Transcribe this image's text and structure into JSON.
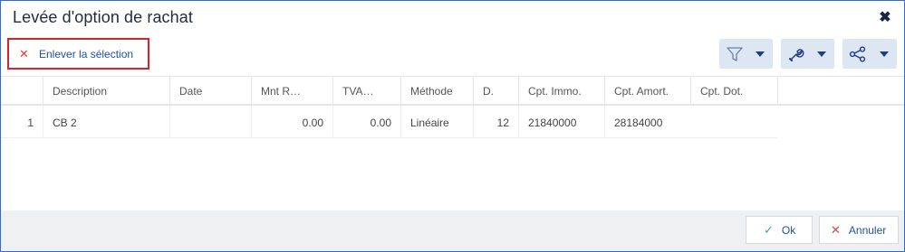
{
  "dialog": {
    "title": "Levée d'option de rachat",
    "close_icon": "close-icon"
  },
  "toolbar": {
    "clear_selection_label": "Enlever la sélection",
    "clear_icon": "x-icon",
    "filter_icon": "filter-icon",
    "tools_icon": "wrench-icon",
    "share_icon": "share-icon"
  },
  "grid": {
    "columns": [
      "",
      "Description",
      "Date",
      "Mnt R…",
      "TVA…",
      "Méthode",
      "D.",
      "Cpt. Immo.",
      "Cpt. Amort.",
      "Cpt. Dot."
    ],
    "rows": [
      {
        "num": "1",
        "description": "CB 2",
        "date": "",
        "mnt": "0.00",
        "tva": "0.00",
        "methode": "Linéaire",
        "d": "12",
        "cpt_immo": "21840000",
        "cpt_amort": "28184000",
        "cpt_dot": ""
      }
    ]
  },
  "footer": {
    "ok_label": "Ok",
    "cancel_label": "Annuler"
  },
  "colors": {
    "accent": "#1f4fa8",
    "highlight_border": "#d8232a",
    "toolbar_button_bg": "#dde6f3",
    "footer_bg": "#eef0f2"
  }
}
